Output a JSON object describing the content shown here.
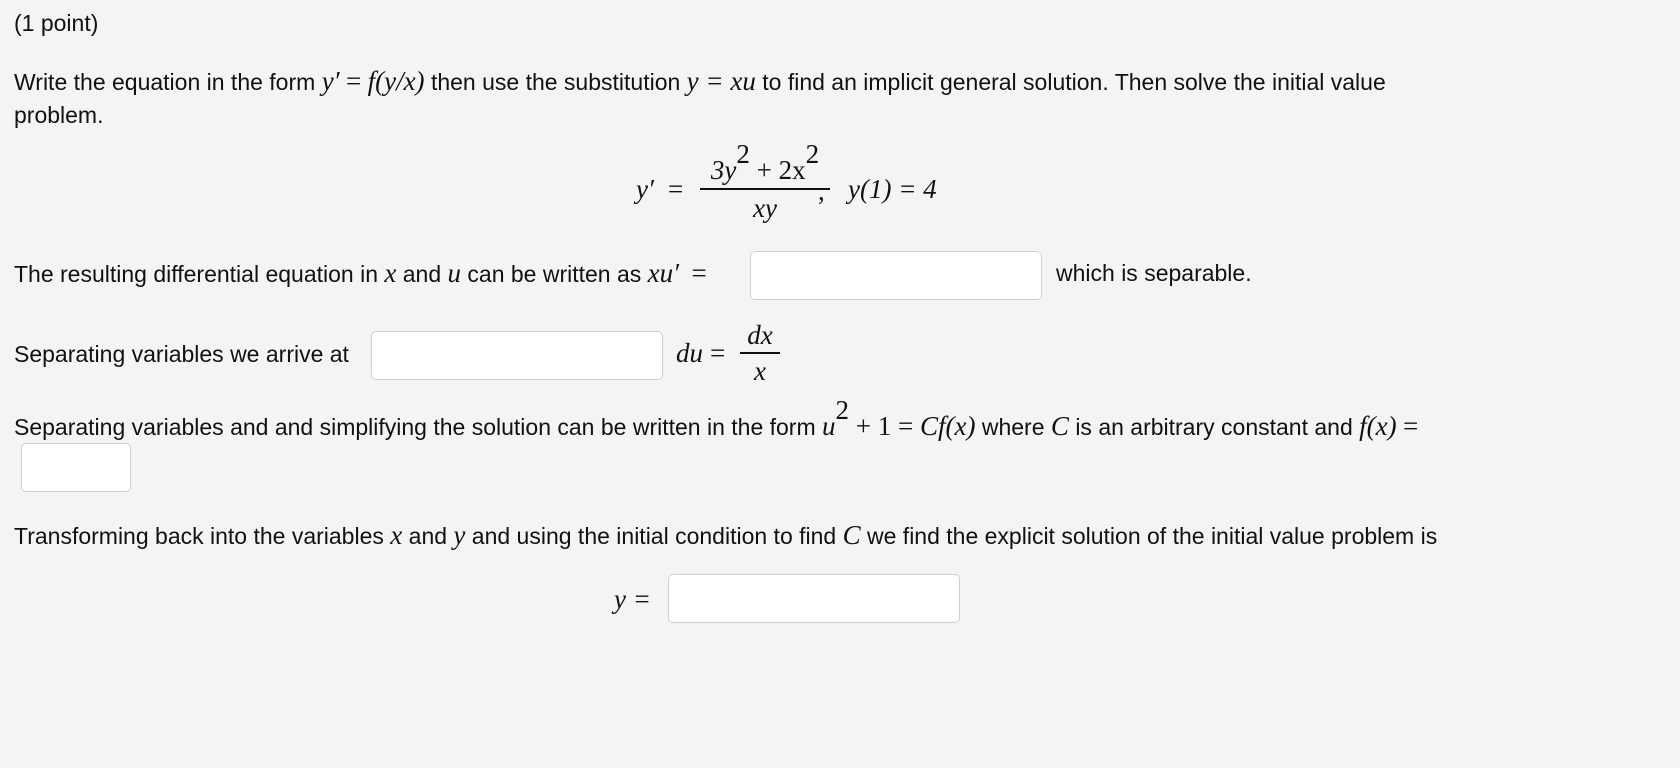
{
  "header": {
    "points": "(1 point)"
  },
  "intro": {
    "t1": "Write the equation in the form",
    "m1a": "y′",
    "m1b": "=",
    "m1c": "f(y/x)",
    "t2": "then use the substitution",
    "m2": "y = xu",
    "t3": "to find an implicit general solution. Then solve the initial value",
    "t4": "problem."
  },
  "equation": {
    "lhs": "y′",
    "eq": "=",
    "num_a": "3y",
    "num_b": " + 2x",
    "exp": "2",
    "den": "xy",
    "comma": ",",
    "ivp": "y(1) = 4"
  },
  "q1": {
    "t1": "The resulting differential equation in",
    "x": "x",
    "and": "and",
    "u": "u",
    "t2": "can be written as",
    "lhs": "xu′",
    "eq": "=",
    "t3": "which is separable.",
    "value": ""
  },
  "q2": {
    "t1": "Separating variables we arrive at",
    "du": "du",
    "eq": "=",
    "num": "dx",
    "den": "x",
    "value": ""
  },
  "q3": {
    "t1": "Separating variables and and simplifying the solution can be written in the form",
    "u": "u",
    "exp": "2",
    "rest": " + 1 = ",
    "cfx": "Cf(x)",
    "t2": "where",
    "C": "C",
    "t3": "is an arbitrary constant and",
    "fx": "f(x)",
    "eq": "=",
    "value": ""
  },
  "q4": {
    "t1": "Transforming back into the variables",
    "x": "x",
    "and": "and",
    "y": "y",
    "t2": "and using the initial condition to find",
    "C": "C",
    "t3": "we find the explicit solution of the initial value problem is",
    "lhs": "y =",
    "value": ""
  }
}
